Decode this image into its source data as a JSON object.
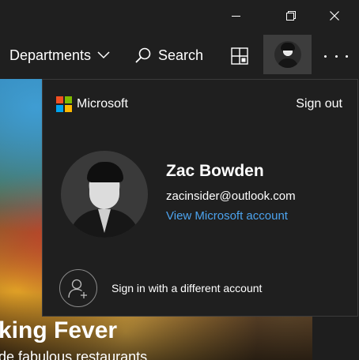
{
  "window": {
    "minimize_icon": "minimize-icon",
    "restore_icon": "restore-icon",
    "close_icon": "close-icon"
  },
  "header": {
    "departments_label": "Departments",
    "search_label": "Search",
    "cart_icon": "grid-icon",
    "more_icon": "ellipsis-icon"
  },
  "hero": {
    "title": "king Fever",
    "subtitle": "de fabulous restaurants"
  },
  "account_flyout": {
    "brand": "Microsoft",
    "sign_out_label": "Sign out",
    "user_name": "Zac Bowden",
    "user_email": "zacinsider@outlook.com",
    "view_account_label": "View Microsoft account",
    "different_account_label": "Sign in with a different account"
  },
  "colors": {
    "link": "#4ca3ee",
    "flyout_bg": "#1f1f1f",
    "avatar_button_bg": "#3d3d3d",
    "ms_red": "#f25022",
    "ms_green": "#7fba00",
    "ms_blue": "#00a4ef",
    "ms_yellow": "#ffb900"
  }
}
